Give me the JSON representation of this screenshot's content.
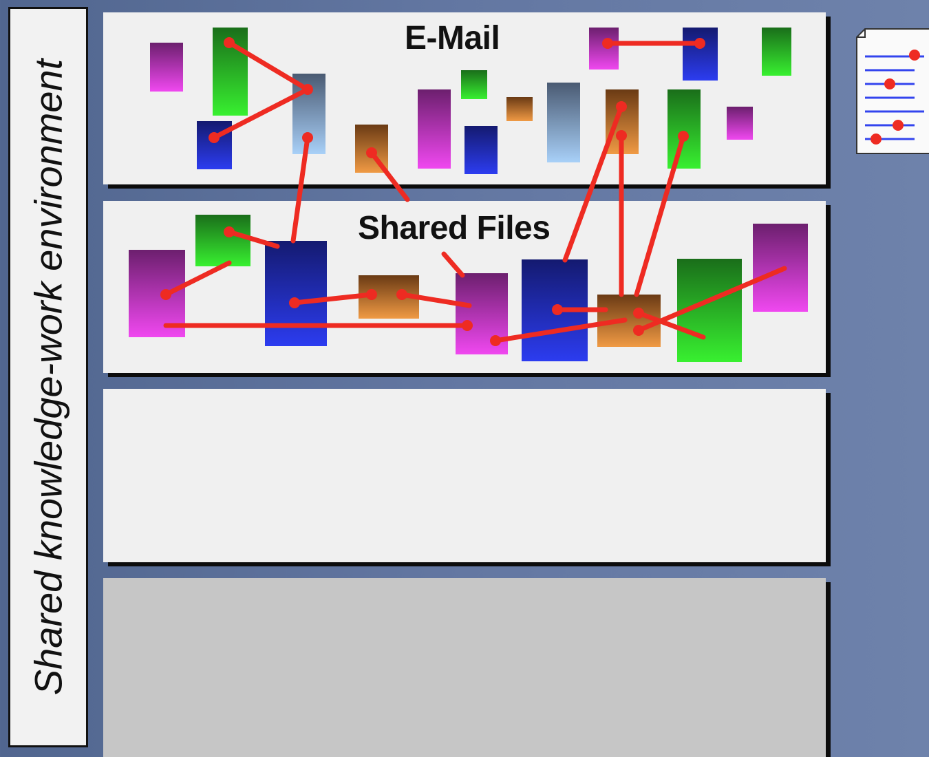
{
  "sidebar": {
    "label": "Shared knowledge-work environment"
  },
  "panels": [
    {
      "title": "E-Mail"
    },
    {
      "title": "Shared Files"
    },
    {
      "title": ""
    },
    {
      "title": ""
    }
  ],
  "colors": {
    "link": "#ee2b22",
    "purple": [
      "#6c1f6e",
      "#f048f0"
    ],
    "green": [
      "#1a6e1a",
      "#38f030"
    ],
    "blue": [
      "#141a70",
      "#2c3cf0"
    ],
    "orange": [
      "#6a3a14",
      "#f09a44"
    ],
    "steel": [
      "#4a5a72",
      "#a8d0f8"
    ]
  },
  "icons": {
    "document": "document-icon"
  }
}
